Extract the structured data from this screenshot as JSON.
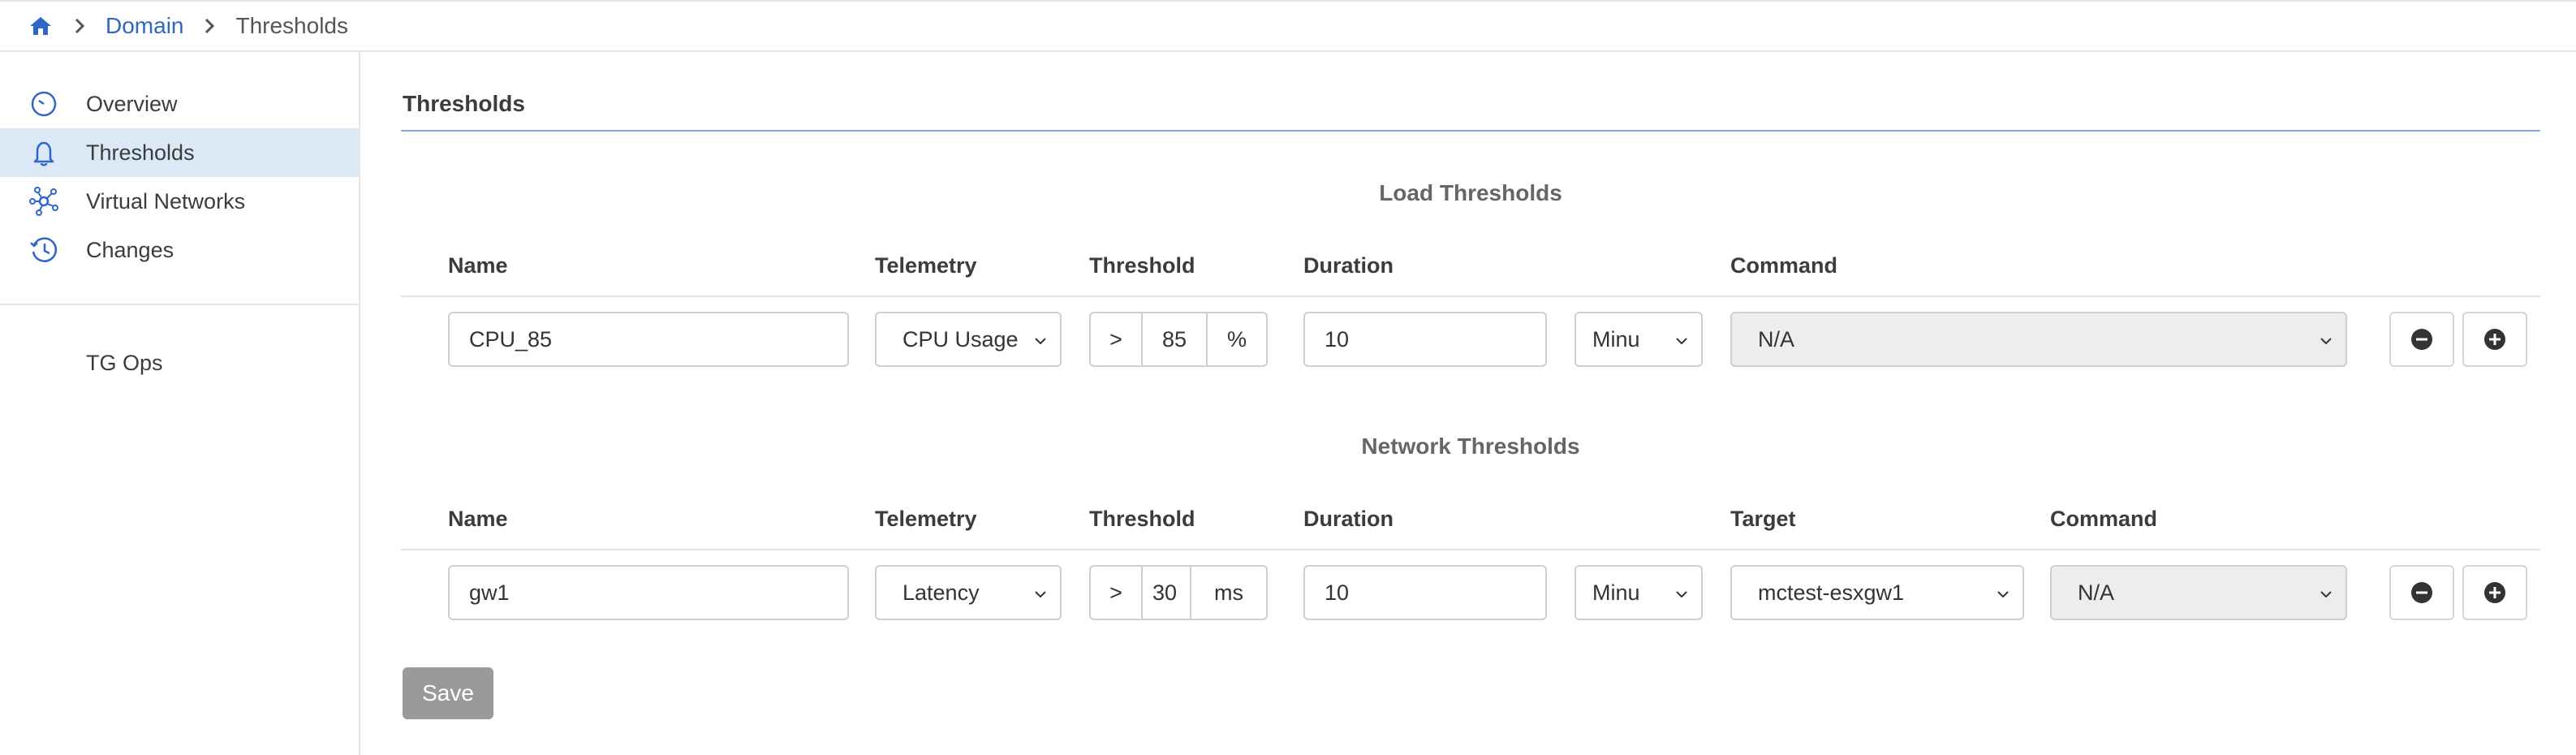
{
  "breadcrumb": {
    "items": [
      "Domain",
      "Thresholds"
    ]
  },
  "sidebar": {
    "items": [
      {
        "label": "Overview",
        "icon": "gauge-icon"
      },
      {
        "label": "Thresholds",
        "icon": "bell-icon"
      },
      {
        "label": "Virtual Networks",
        "icon": "network-icon"
      },
      {
        "label": "Changes",
        "icon": "clock-icon"
      }
    ],
    "active": "Thresholds",
    "group_label": "TG Ops"
  },
  "main": {
    "title": "Thresholds",
    "load": {
      "title": "Load Thresholds",
      "headers": {
        "name": "Name",
        "telemetry": "Telemetry",
        "threshold": "Threshold",
        "duration": "Duration",
        "command": "Command"
      },
      "row": {
        "name": "CPU_85",
        "telemetry": "CPU Usage",
        "operator": ">",
        "threshold_value": "85",
        "unit": "%",
        "duration": "10",
        "duration_unit": "Minu",
        "command": "N/A"
      }
    },
    "network": {
      "title": "Network Thresholds",
      "headers": {
        "name": "Name",
        "telemetry": "Telemetry",
        "threshold": "Threshold",
        "duration": "Duration",
        "target": "Target",
        "command": "Command"
      },
      "row": {
        "name": "gw1",
        "telemetry": "Latency",
        "operator": ">",
        "threshold_value": "30",
        "unit": "ms",
        "duration": "10",
        "duration_unit": "Minu",
        "target": "mctest-esxgw1",
        "command": "N/A"
      }
    },
    "save_label": "Save"
  },
  "colors": {
    "accent": "#2f66c9",
    "active_bg": "#dbe9f7",
    "save_bg": "#9a9a9a"
  }
}
